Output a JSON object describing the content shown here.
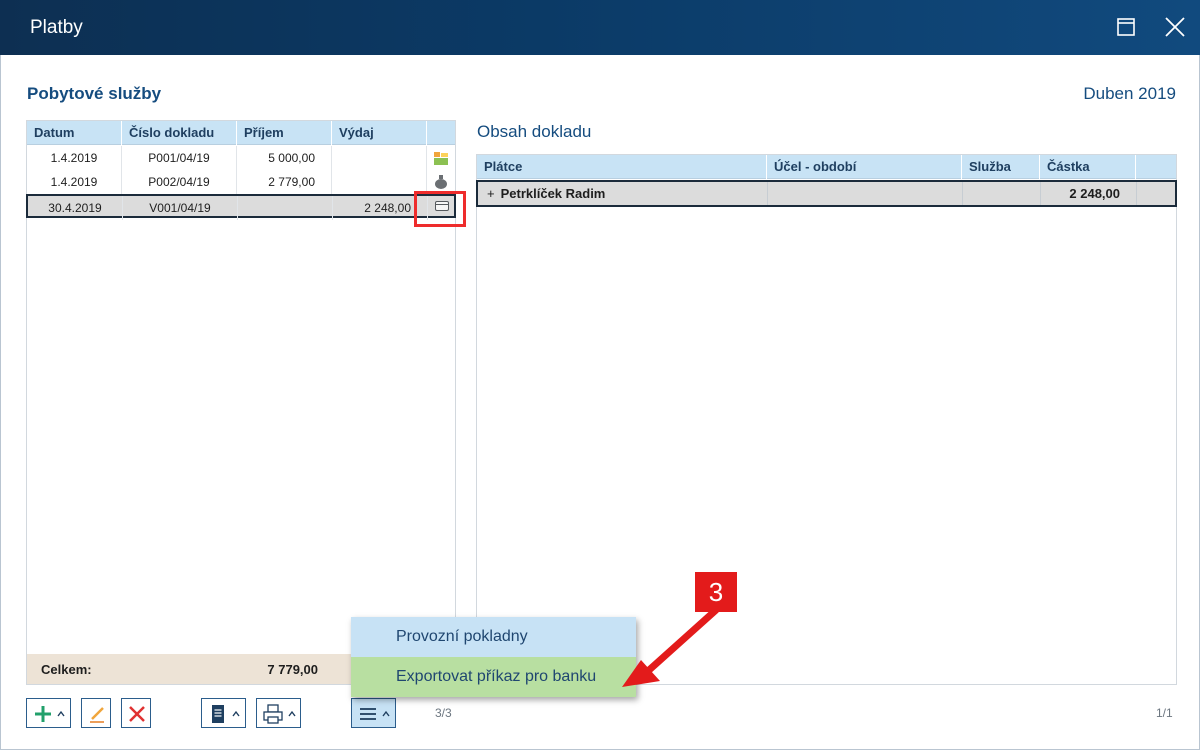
{
  "window": {
    "title": "Platby"
  },
  "header": {
    "section_title": "Pobytové služby",
    "month": "Duben 2019"
  },
  "left_table": {
    "columns": [
      "Datum",
      "Číslo dokladu",
      "Příjem",
      "Výdaj"
    ],
    "rows": [
      {
        "date": "1.4.2019",
        "doc": "P001/04/19",
        "income": "5 000,00",
        "expense": "",
        "icon": "cash-register-icon"
      },
      {
        "date": "1.4.2019",
        "doc": "P002/04/19",
        "income": "2 779,00",
        "expense": "",
        "icon": "piggy-bank-icon"
      },
      {
        "date": "30.4.2019",
        "doc": "V001/04/19",
        "income": "",
        "expense": "2 248,00",
        "icon": "card-icon"
      }
    ],
    "footer": {
      "label": "Celkem:",
      "total": "7 779,00"
    }
  },
  "right_panel": {
    "title": "Obsah dokladu",
    "columns": [
      "Plátce",
      "Účel - období",
      "Služba",
      "Částka"
    ],
    "rows": [
      {
        "payer": "Petrklíček Radim",
        "purpose": "",
        "service": "",
        "amount": "2 248,00",
        "expand": "+"
      }
    ]
  },
  "toolbar": {
    "pager_left": "3/3",
    "pager_right": "1/1",
    "icons": [
      "plus-icon",
      "edit-pencil-icon",
      "delete-x-icon",
      "document-icon",
      "printer-icon",
      "menu-hamburger-icon"
    ]
  },
  "popup_menu": {
    "items": [
      "Provozní pokladny",
      "Exportovat příkaz pro banku"
    ]
  },
  "annotation": {
    "step": "3"
  },
  "colors": {
    "accent": "#154c7f",
    "header_bg": "#c8e3f5",
    "highlight": "#b8dfa1",
    "annotation": "#e31b1b"
  }
}
